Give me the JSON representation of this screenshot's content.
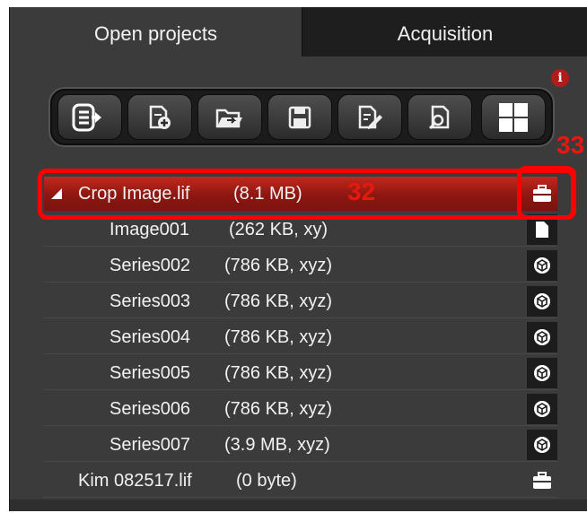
{
  "tabs": [
    {
      "label": "Open projects",
      "active": true
    },
    {
      "label": "Acquisition",
      "active": false
    }
  ],
  "error_indicator": "i",
  "toolbar": {
    "buttons": [
      {
        "icon": "export-list-icon"
      },
      {
        "icon": "new-project-icon"
      },
      {
        "icon": "open-folder-icon"
      },
      {
        "icon": "save-icon"
      },
      {
        "icon": "edit-document-icon"
      },
      {
        "icon": "find-document-icon"
      },
      {
        "icon": "grid-view-icon"
      }
    ]
  },
  "annotations": {
    "a32": "32",
    "a33": "33"
  },
  "tree": {
    "project": {
      "name": "Crop Image.lif",
      "info": "(8.1 MB)",
      "icon": "briefcase-icon",
      "selected": true
    },
    "items": [
      {
        "name": "Image001",
        "info": "(262 KB, xy)",
        "icon": "document-icon"
      },
      {
        "name": "Series002",
        "info": "(786 KB, xyz)",
        "icon": "cube-icon"
      },
      {
        "name": "Series003",
        "info": "(786 KB, xyz)",
        "icon": "cube-icon"
      },
      {
        "name": "Series004",
        "info": "(786 KB, xyz)",
        "icon": "cube-icon"
      },
      {
        "name": "Series005",
        "info": "(786 KB, xyz)",
        "icon": "cube-icon"
      },
      {
        "name": "Series006",
        "info": "(786 KB, xyz)",
        "icon": "cube-icon"
      },
      {
        "name": "Series007",
        "info": "(3.9 MB, xyz)",
        "icon": "cube-icon"
      }
    ],
    "project2": {
      "name": "Kim 082517.lif",
      "info": "(0 byte)",
      "icon": "briefcase-icon"
    }
  },
  "colors": {
    "accent": "#b01c14",
    "annotation": "#ff0000",
    "panel": "#3b3b3b"
  }
}
